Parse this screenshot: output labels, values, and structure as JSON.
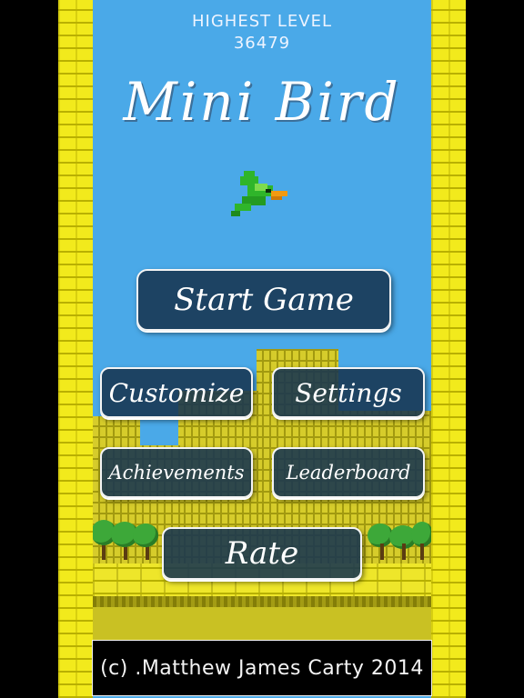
{
  "game": {
    "highest_label": "HIGHEST LEVEL",
    "highest_value": "36479",
    "title": "Mini Bird",
    "bird_icon": "green-bird-icon"
  },
  "menu": {
    "start": "Start Game",
    "customize": "Customize",
    "settings": "Settings",
    "achievements": "Achievements",
    "leaderboard": "Leaderboard",
    "rate": "Rate"
  },
  "footer": {
    "copyright": "(c) .Matthew James Carty 2014"
  },
  "colors": {
    "sky": "#4aa9e8",
    "brick": "#f2ea1c",
    "button_bg": "#173450",
    "bird_green": "#2fb52a",
    "beak": "#f29a12"
  }
}
